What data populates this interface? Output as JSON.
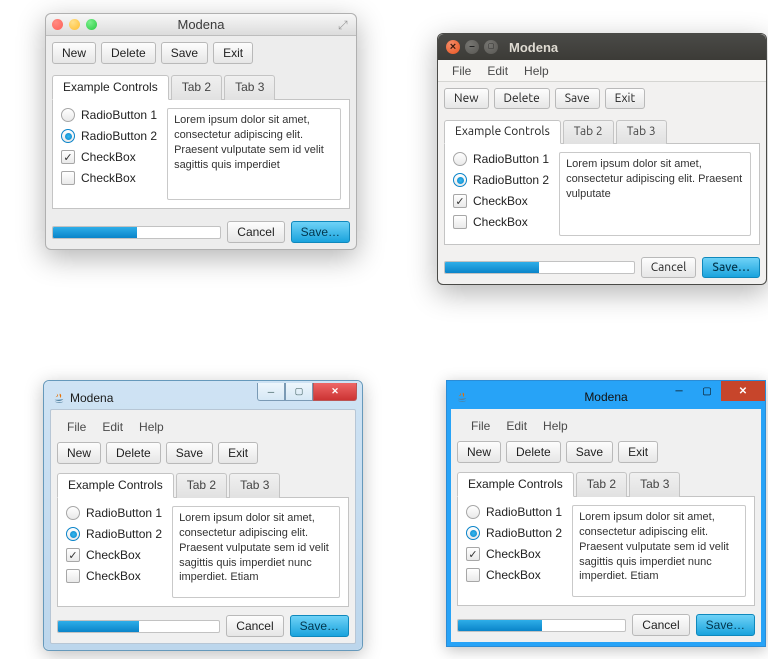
{
  "title": "Modena",
  "menu": {
    "file": "File",
    "edit": "Edit",
    "help": "Help"
  },
  "toolbar": {
    "new": "New",
    "delete": "Delete",
    "save": "Save",
    "exit": "Exit"
  },
  "tabs": [
    "Example Controls",
    "Tab 2",
    "Tab 3"
  ],
  "controls": {
    "radio1": "RadioButton 1",
    "radio2": "RadioButton 2",
    "check1": "CheckBox",
    "check2": "CheckBox",
    "radio_selected": 2,
    "check1_checked": true,
    "check2_checked": false
  },
  "textarea_mac": "Lorem ipsum dolor sit amet, consectetur adipiscing elit. Praesent vulputate sem id velit sagittis quis imperdiet",
  "textarea_ubu": "Lorem ipsum dolor sit amet, consectetur adipiscing elit. Praesent vulputate",
  "textarea_win": "Lorem ipsum dolor sit amet, consectetur adipiscing elit. Praesent vulputate sem id velit sagittis quis imperdiet nunc imperdiet. Etiam",
  "footer": {
    "cancel": "Cancel",
    "save": "Save…"
  },
  "progress_percent": 50,
  "colors": {
    "accent": "#0a84c9"
  }
}
